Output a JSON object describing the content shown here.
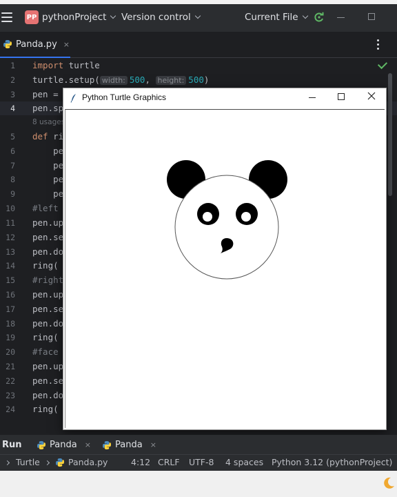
{
  "titlebar": {
    "project_badge": "PP",
    "project_name": "pythonProject",
    "version_control": "Version control",
    "run_config": "Current File"
  },
  "tabs": [
    {
      "label": "Panda.py",
      "close": "×"
    }
  ],
  "editor": {
    "lines": [
      {
        "n": "1"
      },
      {
        "n": "2"
      },
      {
        "n": "3"
      },
      {
        "n": "4"
      },
      {
        "n": "5"
      },
      {
        "n": "6"
      },
      {
        "n": "7"
      },
      {
        "n": "8"
      },
      {
        "n": "9"
      },
      {
        "n": "10"
      },
      {
        "n": "11"
      },
      {
        "n": "12"
      },
      {
        "n": "13"
      },
      {
        "n": "14"
      },
      {
        "n": "15"
      },
      {
        "n": "16"
      },
      {
        "n": "17"
      },
      {
        "n": "18"
      },
      {
        "n": "19"
      },
      {
        "n": "20"
      },
      {
        "n": "21"
      },
      {
        "n": "22"
      },
      {
        "n": "23"
      },
      {
        "n": "24"
      }
    ],
    "code": {
      "l1_kw": "import",
      "l1_rest": " turtle",
      "l2_a": "turtle.setup(",
      "l2_h1": "width:",
      "l2_v1": "500",
      "l2_sep": ", ",
      "l2_h2": "height:",
      "l2_v2": "500",
      "l2_end": ")",
      "l3": "pen =",
      "l4": "pen.sp",
      "usages": "8 usages",
      "l5_kw": "def",
      "l5_rest": " ri",
      "l6": "    pe",
      "l7": "    pe",
      "l8": "    pe",
      "l9": "    pe",
      "l10": "#left",
      "l11": "pen.up",
      "l12": "pen.se",
      "l13": "pen.do",
      "l14": "ring(",
      "l15": "#right",
      "l16": "pen.up",
      "l17": "pen.se",
      "l18": "pen.do",
      "l19": "ring(",
      "l20": "#face",
      "l21": "pen.up",
      "l22": "pen.se",
      "l23": "pen.do",
      "l24": "ring("
    }
  },
  "turtle_window": {
    "title": "Python Turtle Graphics",
    "close_glyph": "✕"
  },
  "runbar": {
    "label": "Run",
    "tabs": [
      {
        "label": "Panda",
        "close": "×"
      },
      {
        "label": "Panda",
        "close": "×"
      }
    ]
  },
  "statusbar": {
    "breadcrumb_1": "Turtle",
    "breadcrumb_2": "Panda.py",
    "position": "4:12",
    "line_sep": "CRLF",
    "encoding": "UTF-8",
    "indent": "4 spaces",
    "interpreter": "Python 3.12 (pythonProject)"
  },
  "colors": {
    "accent": "#3574f0",
    "keyword": "#cf8e6d",
    "number": "#2aacb8",
    "ok_green": "#5fb865",
    "project_badge": "#e57373"
  },
  "icons": [
    "hamburger-icon",
    "chevron-down-icon",
    "reload-icon",
    "minimize-icon",
    "maximize-icon",
    "kebab-icon",
    "checkmark-icon",
    "python-file-icon",
    "feather-icon",
    "close-icon",
    "moon-icon"
  ]
}
